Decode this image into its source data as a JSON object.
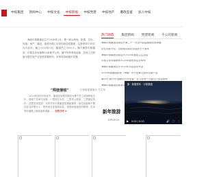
{
  "nav": {
    "items": [
      {
        "label": "中核集团",
        "active": false
      },
      {
        "label": "新闻中心",
        "active": false
      },
      {
        "label": "中核文化",
        "active": false
      },
      {
        "label": "中核影视",
        "active": true
      },
      {
        "label": "中核党建",
        "active": false
      },
      {
        "label": "中核地产",
        "active": false
      },
      {
        "label": "廉政监督",
        "active": false
      },
      {
        "label": "加入中核",
        "active": false
      }
    ]
  },
  "intro": {
    "text": "海南中核集团创立于2008年1月，是一家以房地、影视、文化、传媒、地产、建设、投资为核心业务的综合性集团，注册资本5.08亿元人民币。截止2020年3月，集团员工3000人，旗下拥有中核建设、中核文化传媒等10余家子公司，旗下所有有效运营，总体上已跻身中国文旅产业投资发展前列，未来将持续稳步发展。"
  },
  "quote": {
    "title": "\"师徒接班\"",
    "source": "中核集团董事长 刘文军",
    "body": "2020年农历中秋佳节，集团总经理刘俊岐为骨干员工讲授师徒文化，强调了传承与创新，一是德才为先，二是学以致用，三是团结协作，四是坚持发扬，共同书写中核集团发展新篇章，各位技能骨干要切实当好带头人，把传承文化落到实处，体现师徒接班的精神，在未来的道路上继续追求卓越……",
    "more": "查看详情 ➤"
  },
  "news": {
    "tabs": [
      {
        "label": "热门动态",
        "active": true
      },
      {
        "label": "集团新闻",
        "active": false
      },
      {
        "label": "党建新闻",
        "active": false
      },
      {
        "label": "千公司新闻",
        "active": false
      }
    ],
    "items": [
      "海南中核集团党委召开第二十一次党代会暨集团党委换届",
      "历任党委书记、总经理合影纪念国庆七十周年",
      "海南中核集团党委召开2020年度民主生活会",
      "中核文化传媒荣获2020年度优秀企业称号",
      "海南中核集团召开2020年总结表彰大会",
      "2020年度集团影视（海南）举行全景文旅项目推介会",
      "新时代 新作为 做新时代开拓者：学习贯彻十九届五中全会精神",
      "海南中核集团党委宣讲十九届五中全会精神"
    ]
  },
  "video": {
    "caption": "集 · 新春贺年 · 中核集团",
    "time": "0:00 / 0:20",
    "play_icon": "play-icon",
    "volume_icon": "volume-icon",
    "fullscreen_icon": "fullscreen-icon",
    "more_icon": "more-icon"
  },
  "feature": {
    "title": "新年致辞",
    "subtitle": "SPEECH"
  },
  "colors": {
    "accent": "#c8161d",
    "text": "#555555",
    "video_bg": "#0c1220"
  }
}
